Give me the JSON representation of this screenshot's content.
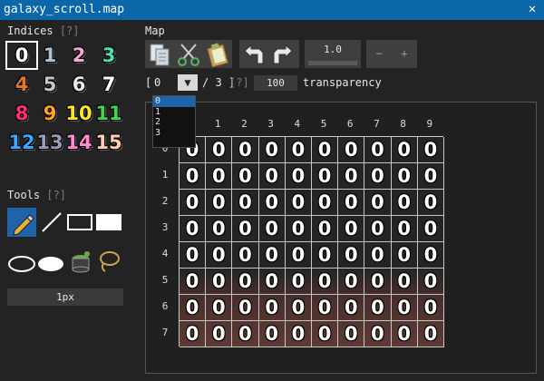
{
  "window": {
    "title": "galaxy_scroll.map",
    "close_glyph": "✕"
  },
  "indices": {
    "heading": "Indices",
    "help": "[?]",
    "selected": 0,
    "items": [
      {
        "label": "0",
        "color": "#ffffff"
      },
      {
        "label": "1",
        "color": "#b0c4d8"
      },
      {
        "label": "2",
        "color": "#f2a9d8"
      },
      {
        "label": "3",
        "color": "#4fe0b0"
      },
      {
        "label": "4",
        "color": "#d9782e"
      },
      {
        "label": "5",
        "color": "#c7c7c7"
      },
      {
        "label": "6",
        "color": "#e8e8e8"
      },
      {
        "label": "7",
        "color": "#ffffff"
      },
      {
        "label": "8",
        "color": "#ff2d7a"
      },
      {
        "label": "9",
        "color": "#ffa320"
      },
      {
        "label": "10",
        "color": "#ffe626"
      },
      {
        "label": "11",
        "color": "#3ed64b"
      },
      {
        "label": "12",
        "color": "#3aa6ff"
      },
      {
        "label": "13",
        "color": "#9c9cba"
      },
      {
        "label": "14",
        "color": "#ff8ccf"
      },
      {
        "label": "15",
        "color": "#ffcfb5"
      }
    ]
  },
  "tools": {
    "heading": "Tools",
    "help": "[?]",
    "size_label": "1px",
    "icons": [
      "pencil-icon",
      "line-icon",
      "rect-outline-icon",
      "rect-filled-icon",
      "ellipse-outline-icon",
      "ellipse-filled-icon",
      "bucket-icon",
      "lasso-icon"
    ]
  },
  "map": {
    "heading": "Map",
    "toolbar_icons": [
      "copy-icon",
      "cut-icon",
      "paste-icon",
      "undo-icon",
      "redo-icon"
    ],
    "zoom_value": "1.0",
    "minus_label": "−",
    "plus_label": "+",
    "layer": {
      "open_bracket": "[",
      "current": "0",
      "arrow": "▼",
      "total_text": "/ 3 ]",
      "help": "[?]",
      "options": [
        "0",
        "1",
        "2",
        "3"
      ]
    },
    "transparency_value": "100",
    "transparency_label": "transparency",
    "columns": [
      "0",
      "1",
      "2",
      "3",
      "4",
      "5",
      "6",
      "7",
      "8",
      "9"
    ],
    "rows": [
      "0",
      "1",
      "2",
      "3",
      "4",
      "5",
      "6",
      "7"
    ],
    "cell_value": "0"
  }
}
